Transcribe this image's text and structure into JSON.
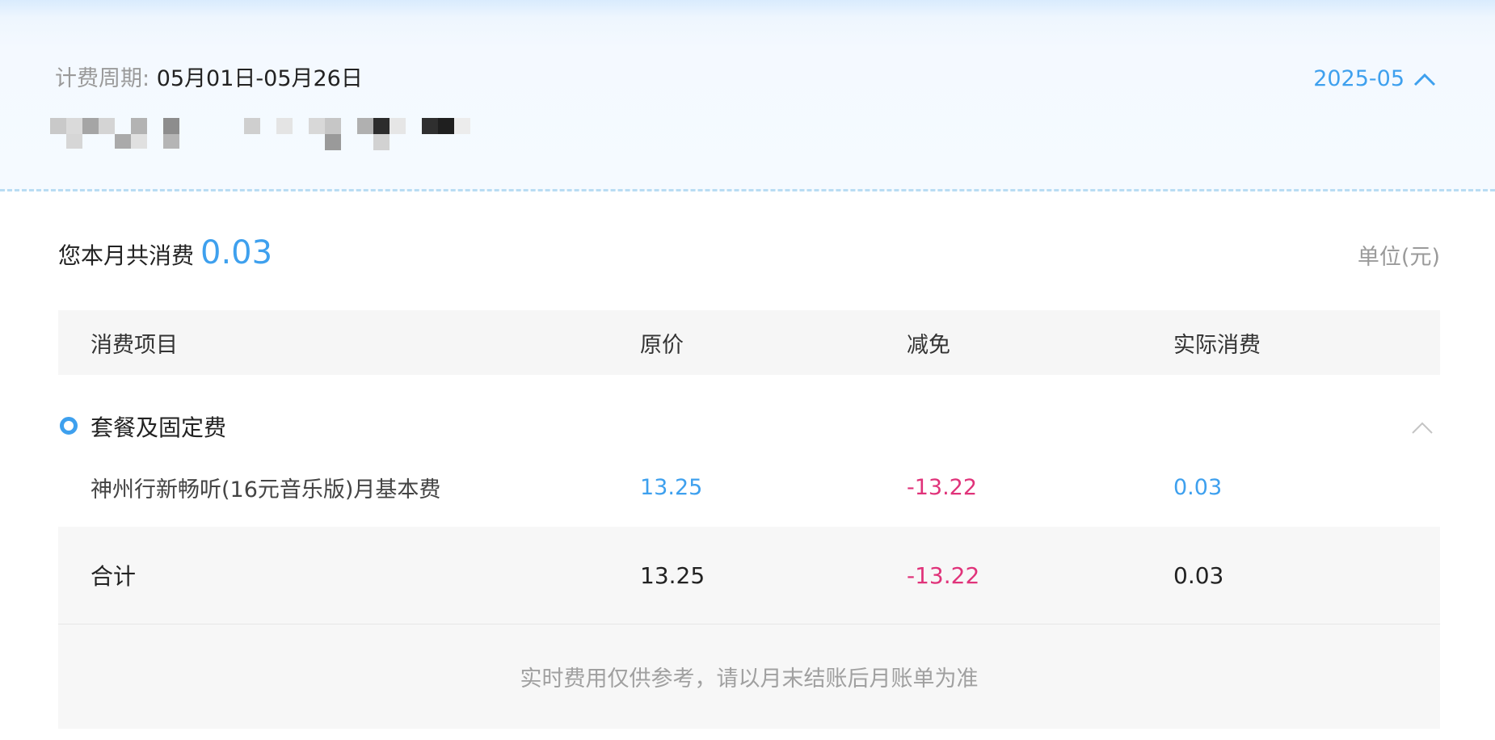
{
  "billing": {
    "cycle_label": "计费周期: ",
    "cycle_value": "05月01日-05月26日",
    "month": "2025-05"
  },
  "summary": {
    "label": "您本月共消费",
    "amount": "0.03",
    "unit": "单位(元)"
  },
  "table": {
    "headers": [
      "消费项目",
      "原价",
      "减免",
      "实际消费"
    ],
    "group": {
      "title": "套餐及固定费",
      "items": [
        {
          "name": "神州行新畅听(16元音乐版)月基本费",
          "original": "13.25",
          "discount": "-13.22",
          "actual": "0.03"
        }
      ]
    },
    "total": {
      "label": "合计",
      "original": "13.25",
      "discount": "-13.22",
      "actual": "0.03"
    },
    "note": "实时费用仅供参考，请以月末结账后月账单为准"
  },
  "colors": {
    "accent": "#3ea0ee",
    "discount": "#e0337a",
    "muted": "#9a9a9a"
  }
}
